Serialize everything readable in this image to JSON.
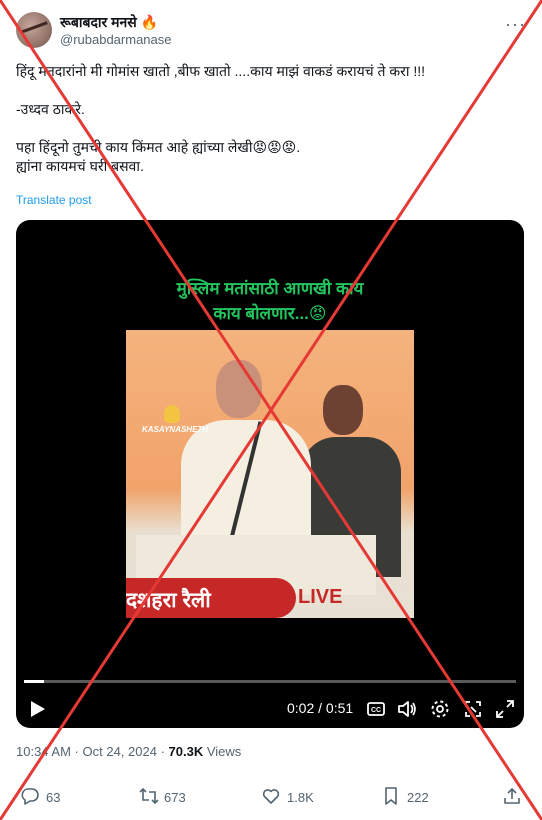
{
  "author": {
    "display_name": "रूबाबदार मनसे 🔥",
    "handle": "@rubabdarmanase"
  },
  "more_icon": "more-dots-icon",
  "tweet": {
    "line1": "हिंदू मतदारांनो मी गोमांस खातो ,बीफ खातो ....काय माझं वाकडं करायचं ते करा !!!",
    "line2": "-उध्दव ठाकरे.",
    "line3": "पहा हिंदूनो तुमची काय किंमत आहे ह्यांच्या लेखी😡😡😡.",
    "line4": "ह्यांना कायमचं घरी बसवा.",
    "translate": "Translate post"
  },
  "video": {
    "overlay_line1": "मुस्लिम मतांसाठी आणखी काय",
    "overlay_line2": "काय बोलणार...😡",
    "watermark": "KASAYNASHETH",
    "banner_text": "दशहरा रैली",
    "banner_live": "LIVE",
    "time_display": "0:02 / 0:51",
    "progress_fraction": 0.04
  },
  "meta": {
    "time": "10:34 AM",
    "separator": " · ",
    "date": "Oct 24, 2024",
    "views_count": "70.3K",
    "views_label": " Views"
  },
  "actions": {
    "replies": "63",
    "reposts": "673",
    "likes": "1.8K",
    "bookmarks": "222"
  },
  "colors": {
    "accent": "#1d9bf0",
    "overlay_green": "#22c55e",
    "banner_red": "#c62828",
    "cross_red": "#e53935"
  }
}
